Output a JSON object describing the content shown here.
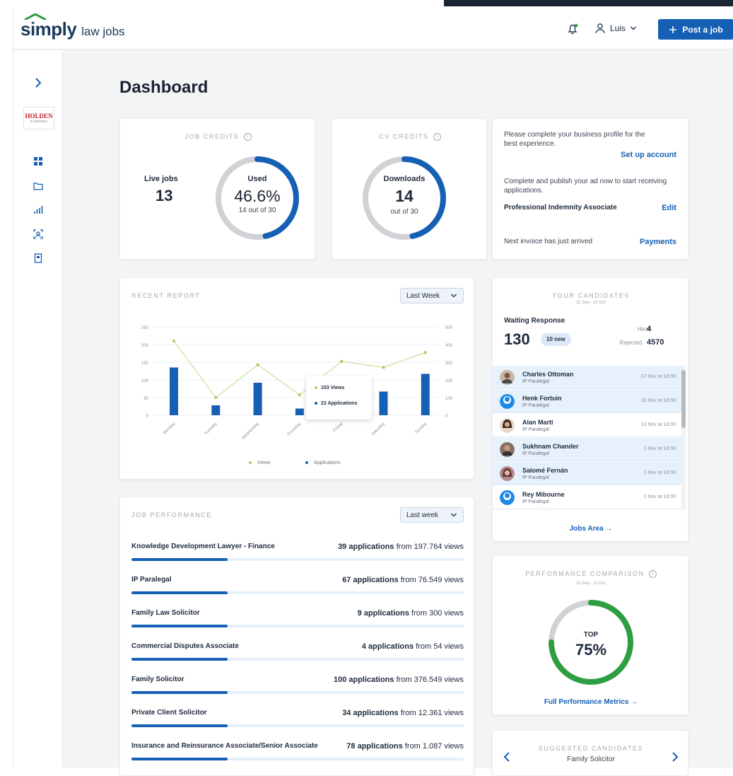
{
  "header": {
    "logo_main": "simply",
    "logo_sub": "law jobs",
    "user_name": "Luis",
    "post_job_label": "Post a job"
  },
  "sidebar": {
    "brand_name": "HOLDEN",
    "brand_sub": "& PARTNERS"
  },
  "page": {
    "title": "Dashboard"
  },
  "job_credits": {
    "label": "JOB CREDITS",
    "live_label": "Live jobs",
    "live_value": "13",
    "used_label": "Used",
    "used_percent": "46.6%",
    "used_detail": "14 out of 30",
    "progress": 0.466
  },
  "cv_credits": {
    "label": "CV CREDITS",
    "downloads_label": "Downloads",
    "downloads_value": "14",
    "downloads_detail": "out of 30",
    "progress": 0.466
  },
  "notifications": {
    "msg1": "Please complete your business profile for the best experience.",
    "link1": "Set up account",
    "msg2": "Complete and publish your ad now to start receiving applications.",
    "job_name": "Professional Indemnity Associate",
    "link2": "Edit",
    "msg3": "Next invoice has just arrived",
    "link3": "Payments"
  },
  "recent_report": {
    "label": "RECENT REPORT",
    "filter": "Last Week",
    "tooltip_views": "153 Views",
    "tooltip_apps": "23 Applications",
    "legend_views": "Views",
    "legend_apps": "Applications"
  },
  "chart_data": {
    "type": "bar",
    "categories": [
      "Monday",
      "Tuesday",
      "Wednesday",
      "Thursday",
      "Friday",
      "Saturday",
      "Sunday"
    ],
    "left_ticks": [
      "0",
      "50",
      "100",
      "150",
      "200",
      "250"
    ],
    "right_ticks": [
      "0",
      "100",
      "200",
      "300",
      "400",
      "500"
    ],
    "series": [
      {
        "name": "Applications",
        "values": [
          135,
          28,
          92,
          19,
          110,
          67,
          117
        ],
        "axis": "left",
        "kind": "bar"
      },
      {
        "name": "Views",
        "values": [
          420,
          100,
          285,
          115,
          305,
          270,
          355
        ],
        "axis": "right",
        "kind": "line"
      }
    ],
    "ylim_left": [
      0,
      250
    ],
    "ylim_right": [
      0,
      500
    ]
  },
  "candidates": {
    "label": "YOUR CANDIDATES",
    "range": "11 Sep - 18 Oct",
    "waiting_label": "Waiting Response",
    "waiting_value": "130",
    "new_badge": "10 new",
    "hired_label": "Hired",
    "hired_value": "4",
    "rejected_label": "Rejected",
    "rejected_value": "4570",
    "list": [
      {
        "name": "Charles Ottoman",
        "role": "IP Paralegal",
        "date": "17 Nov at 18:00"
      },
      {
        "name": "Henk Fortuin",
        "role": "IP Paralegal",
        "date": "16 Nov at 18:00"
      },
      {
        "name": "Alan Martí",
        "role": "IP Paralegal",
        "date": "13 Nov at 18:00"
      },
      {
        "name": "Sukhnam Chander",
        "role": "IP Paralegal",
        "date": "1 Nov at 18:00"
      },
      {
        "name": "Salomé Fernán",
        "role": "IP Paralegal",
        "date": "1 Nov at 18:00"
      },
      {
        "name": "Rey Mibourne",
        "role": "IP Paralegal",
        "date": "1 Nov at 18:00"
      }
    ],
    "jobs_link": "Jobs Area →"
  },
  "job_performance": {
    "label": "JOB PERFORMANCE",
    "filter": "Last week",
    "rows": [
      {
        "job": "Knowledge Development Lawyer - Finance",
        "apps": "39 applications",
        "views": "from 197.764 views"
      },
      {
        "job": "IP Paralegal",
        "apps": "67 applications",
        "views": "from 76.549 views"
      },
      {
        "job": "Family Law Solicitor",
        "apps": "9 applications",
        "views": "from 300 views"
      },
      {
        "job": "Commercial Disputes Associate",
        "apps": "4 applications",
        "views": "from 54 views"
      },
      {
        "job": "Family Solicitor",
        "apps": "100 applications",
        "views": "from 376.549 views"
      },
      {
        "job": "Private Client Solicitor",
        "apps": "34 applications",
        "views": "from 12.361 views"
      },
      {
        "job": "Insurance and Reinsurance Associate/Senior Associate",
        "apps": "78 applications",
        "views": "from 1.087 views"
      }
    ]
  },
  "performance_comparison": {
    "label": "PERFORMANCE COMPARISON",
    "range": "11 Sep - 15 Oct",
    "top_label": "TOP",
    "value": "75%",
    "progress": 0.75,
    "link": "Full Performance Metrics →"
  },
  "suggested": {
    "label": "SUGGESTED CANDIDATES",
    "role": "Family Solicitor"
  },
  "colors": {
    "accent": "#1560b4",
    "green": "#2e9e43",
    "ring_bg": "#d0d2d6"
  }
}
